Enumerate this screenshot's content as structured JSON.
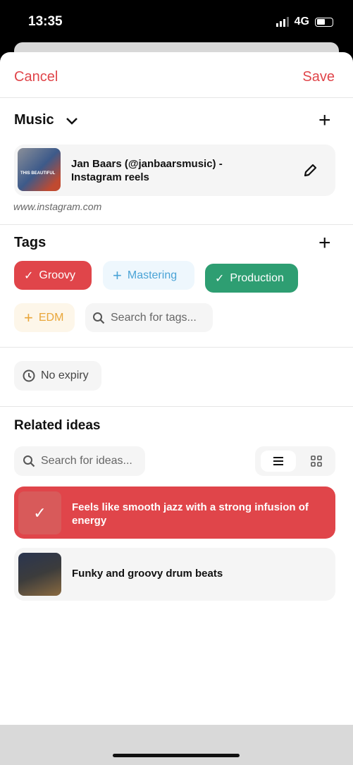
{
  "status": {
    "time": "13:35",
    "network": "4G"
  },
  "header": {
    "cancel": "Cancel",
    "save": "Save"
  },
  "music": {
    "title": "Music",
    "item": {
      "title": "Jan Baars (@janbaarsmusic) - Instagram reels",
      "thumb_text": "THIS BEAUTIFUL",
      "source": "www.instagram.com"
    }
  },
  "tags": {
    "title": "Tags",
    "items": [
      {
        "label": "Groovy",
        "selected": true,
        "color": "#e0454a"
      },
      {
        "label": "Mastering",
        "selected": false,
        "color": "#4aa3d6"
      },
      {
        "label": "Production",
        "selected": true,
        "color": "#2e9e72"
      },
      {
        "label": "EDM",
        "selected": false,
        "color": "#e9a63a"
      }
    ],
    "search_placeholder": "Search for tags..."
  },
  "expiry": {
    "label": "No expiry"
  },
  "related": {
    "title": "Related ideas",
    "search_placeholder": "Search for ideas...",
    "view": "list",
    "items": [
      {
        "title": "Feels like smooth jazz with a strong infusion of energy",
        "selected": true
      },
      {
        "title": "Funky and groovy drum beats",
        "selected": false
      }
    ]
  },
  "colors": {
    "accent": "#e0454a",
    "green": "#2e9e72"
  }
}
